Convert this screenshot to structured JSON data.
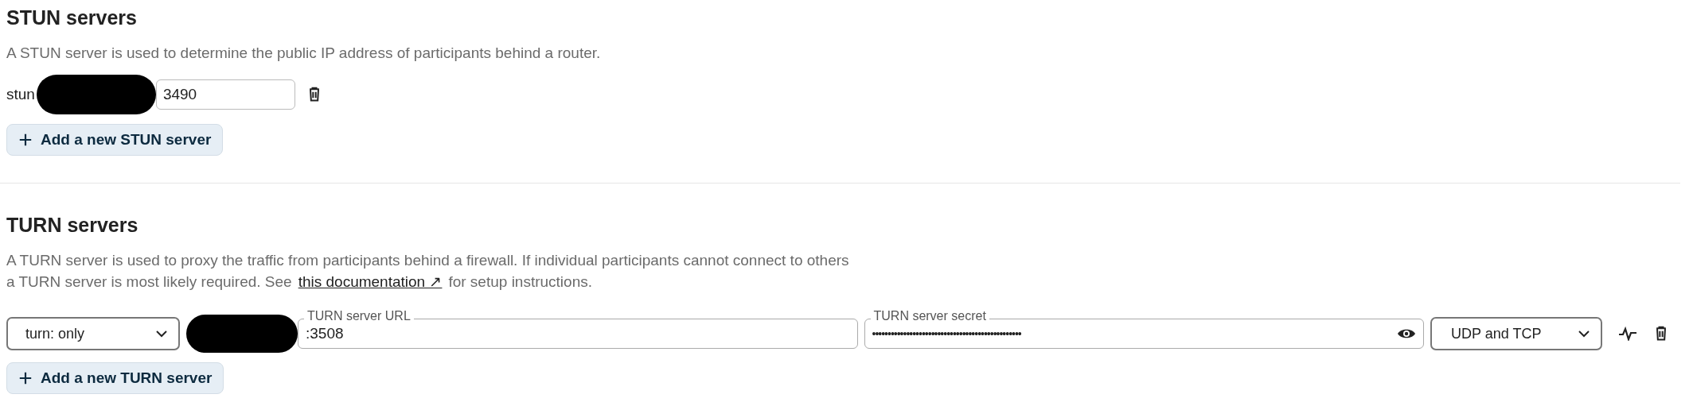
{
  "stun": {
    "title": "STUN servers",
    "description": "A STUN server is used to determine the public IP address of participants behind a router.",
    "servers": [
      {
        "value_start": "stun",
        "value_end": "3490",
        "redacted": true
      }
    ],
    "add_button": "Add a new STUN server"
  },
  "turn": {
    "title": "TURN servers",
    "description_lines": [
      "A TURN server is used to proxy the traffic from participants behind a firewall. If individual participants cannot connect to others",
      "a TURN server is most likely required. See"
    ],
    "link": "this documentation ↗",
    "description_end": "for setup instructions.",
    "servers": [
      {
        "scheme": "turn: only",
        "url_label": "TURN server URL",
        "url_value": ":3508",
        "redacted": true,
        "secret_label": "TURN server secret",
        "secret": "••••••••••••••••••••••••••••••••••••••••••••••••",
        "protocol": "UDP and TCP"
      }
    ],
    "add_button": "Add a new TURN server"
  }
}
